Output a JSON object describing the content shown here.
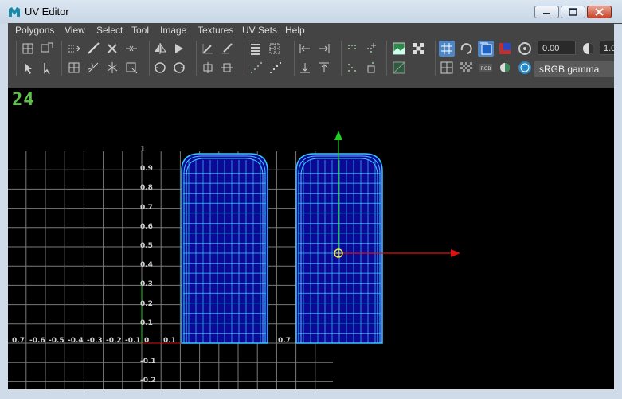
{
  "window": {
    "title": "UV Editor"
  },
  "menu": [
    "Polygons",
    "View",
    "Select",
    "Tool",
    "Image",
    "Textures",
    "UV Sets",
    "Help"
  ],
  "toolbar": {
    "value_field": "0.00",
    "value_field2": "1.0",
    "color_space": "sRGB gamma"
  },
  "viewport": {
    "frame_number": "24",
    "u_labels": [
      "0.7",
      "-0.6",
      "-0.5",
      "-0.4",
      "-0.3",
      "-0.2",
      "-0.1",
      "0",
      "0.1",
      "0.7"
    ],
    "v_labels": [
      "1",
      "0.9",
      "0.8",
      "0.7",
      "0.6",
      "0.5",
      "0.4",
      "0.3",
      "0.2",
      "0.1",
      "-0.1",
      "-0.2"
    ]
  },
  "colors": {
    "uv_fill": "#0a0a96",
    "uv_wire": "#3cc6ff",
    "grid": "#7a7a7a",
    "axis_u": "#e01010",
    "axis_v": "#20d020",
    "panel": "#444444"
  }
}
